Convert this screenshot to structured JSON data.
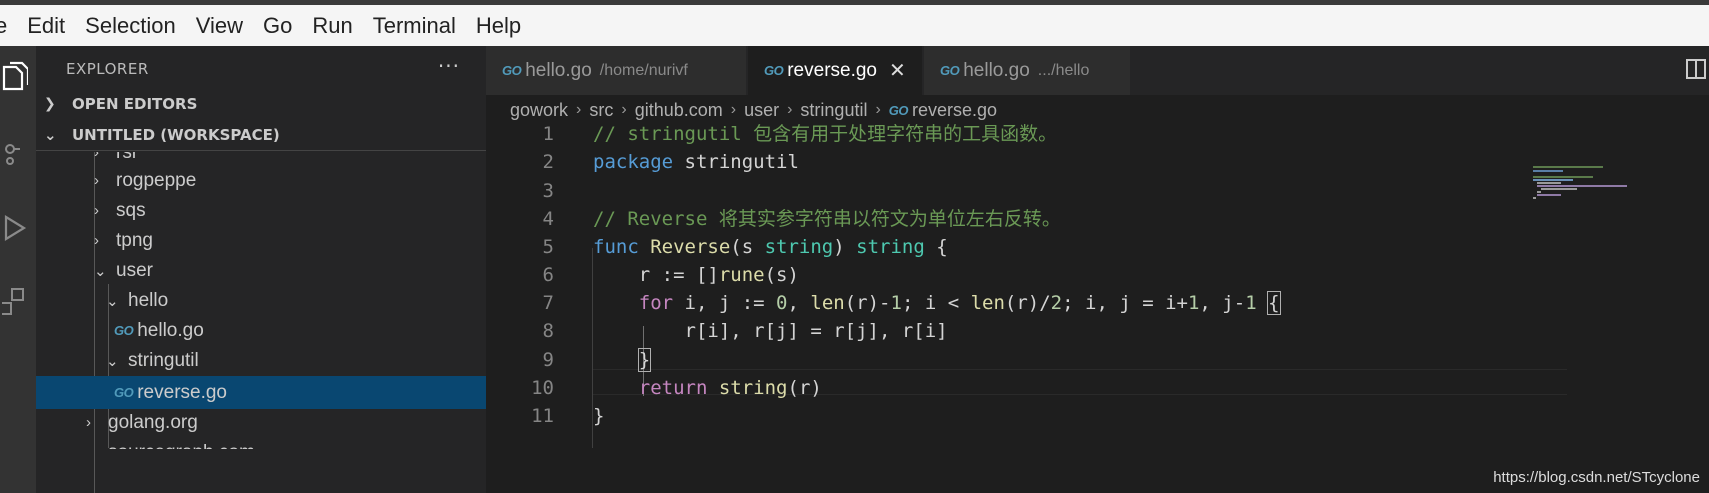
{
  "menubar": {
    "items": [
      "e",
      "Edit",
      "Selection",
      "View",
      "Go",
      "Run",
      "Terminal",
      "Help"
    ]
  },
  "sidebar": {
    "title": "EXPLORER",
    "more": "···",
    "sections": {
      "open_editors": "OPEN EDITORS",
      "workspace": "UNTITLED (WORKSPACE)"
    },
    "tree": [
      {
        "label": "rsi",
        "chevron": "›"
      },
      {
        "label": "rogpeppe",
        "chevron": "›"
      },
      {
        "label": "sqs",
        "chevron": "›"
      },
      {
        "label": "tpng",
        "chevron": "›"
      },
      {
        "label": "user",
        "chevron": "⌄"
      },
      {
        "label": "hello",
        "chevron": "⌄"
      },
      {
        "label": "hello.go",
        "icon": "GO"
      },
      {
        "label": "stringutil",
        "chevron": "⌄"
      },
      {
        "label": "reverse.go",
        "icon": "GO"
      },
      {
        "label": "golang.org",
        "chevron": "›"
      },
      {
        "label": "sourcegraph.com",
        "chevron": "›"
      }
    ]
  },
  "tabs": [
    {
      "label": "hello.go",
      "desc": "/home/nurivf",
      "icon": "GO"
    },
    {
      "label": "reverse.go",
      "desc": "",
      "icon": "GO",
      "close": "✕"
    },
    {
      "label": "hello.go",
      "desc": ".../hello",
      "icon": "GO"
    }
  ],
  "breadcrumb": [
    "gowork",
    "src",
    "github.com",
    "user",
    "stringutil",
    "reverse.go"
  ],
  "breadcrumb_sep": "›",
  "code": {
    "line_numbers": [
      "1",
      "2",
      "3",
      "4",
      "5",
      "6",
      "7",
      "8",
      "9",
      "10",
      "11"
    ],
    "lines": [
      [
        {
          "t": "// stringutil 包含有用于处理字符串的工具函数。",
          "c": "c-com"
        }
      ],
      [
        {
          "t": "package ",
          "c": "c-kw"
        },
        {
          "t": "stringutil",
          "c": ""
        }
      ],
      [],
      [
        {
          "t": "// Reverse 将其实参字符串以符文为单位左右反转。",
          "c": "c-com"
        }
      ],
      [
        {
          "t": "func ",
          "c": "c-kw"
        },
        {
          "t": "Reverse",
          "c": "c-fn"
        },
        {
          "t": "(s ",
          "c": ""
        },
        {
          "t": "string",
          "c": "c-ty"
        },
        {
          "t": ") ",
          "c": ""
        },
        {
          "t": "string",
          "c": "c-ty"
        },
        {
          "t": " {",
          "c": ""
        }
      ],
      [
        {
          "t": "    r := []",
          "c": ""
        },
        {
          "t": "rune",
          "c": "c-fn"
        },
        {
          "t": "(s)",
          "c": ""
        }
      ],
      [
        {
          "t": "    ",
          "c": ""
        },
        {
          "t": "for",
          "c": "c-ctl"
        },
        {
          "t": " i, j := ",
          "c": ""
        },
        {
          "t": "0",
          "c": "c-num"
        },
        {
          "t": ", ",
          "c": ""
        },
        {
          "t": "len",
          "c": "c-fn"
        },
        {
          "t": "(r)-",
          "c": ""
        },
        {
          "t": "1",
          "c": "c-num"
        },
        {
          "t": "; i < ",
          "c": ""
        },
        {
          "t": "len",
          "c": "c-fn"
        },
        {
          "t": "(r)/",
          "c": ""
        },
        {
          "t": "2",
          "c": "c-num"
        },
        {
          "t": "; i, j = i+",
          "c": ""
        },
        {
          "t": "1",
          "c": "c-num"
        },
        {
          "t": ", j-",
          "c": ""
        },
        {
          "t": "1",
          "c": "c-num"
        },
        {
          "t": " ",
          "c": ""
        },
        {
          "t": "{",
          "c": "bm"
        }
      ],
      [
        {
          "t": "        r[i], r[j] = r[j], r[i]",
          "c": ""
        }
      ],
      [
        {
          "t": "    ",
          "c": ""
        },
        {
          "t": "}",
          "c": "bm"
        }
      ],
      [
        {
          "t": "    ",
          "c": ""
        },
        {
          "t": "return",
          "c": "c-ctl"
        },
        {
          "t": " ",
          "c": ""
        },
        {
          "t": "string",
          "c": "c-fn"
        },
        {
          "t": "(r)",
          "c": ""
        }
      ],
      [
        {
          "t": "}",
          "c": ""
        }
      ]
    ]
  },
  "watermark": "https://blog.csdn.net/STcyclone"
}
